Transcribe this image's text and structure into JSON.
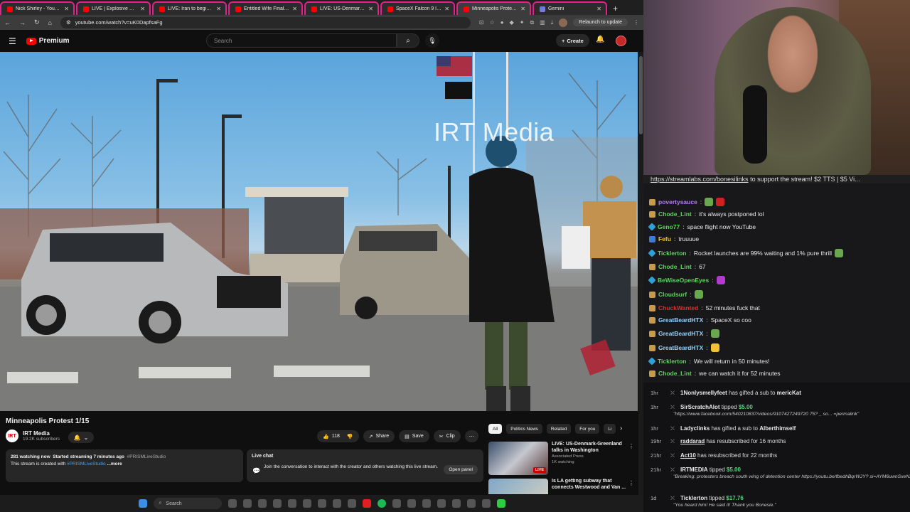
{
  "browser": {
    "tabs": [
      {
        "title": "Nick Shirley - YouTube",
        "active": false
      },
      {
        "title": "LIVE | Explosive House he",
        "active": false
      },
      {
        "title": "LIVE: Iran to begin public",
        "active": false
      },
      {
        "title": "Entitled Wife Finally Meet",
        "active": false
      },
      {
        "title": "LIVE: US-Denmark-Greenl",
        "active": false
      },
      {
        "title": "SpaceX Falcon 9 launche",
        "active": false
      },
      {
        "title": "Minneapolis Protest 1",
        "active": true
      },
      {
        "title": "Gemini",
        "active": false
      }
    ],
    "url": "youtube.com/watch?v=uK0DapfsaFg",
    "relaunch_label": "Relaunch to update"
  },
  "youtube": {
    "logo_text": "Premium",
    "search_placeholder": "Search",
    "create_label": "Create",
    "video": {
      "watermark": "IRT Media",
      "title": "Minneapolis Protest 1/15",
      "channel_name": "IRT Media",
      "channel_logo": "IRT",
      "subscribers": "19.2K subscribers",
      "likes": "118",
      "share_label": "Share",
      "save_label": "Save",
      "clip_label": "Clip"
    },
    "description": {
      "line1_watching": "281 watching now",
      "line1_started": "Started streaming 7 minutes ago",
      "line1_tag": "#PRISMLiveStudio",
      "line2_prefix": "This stream is created with ",
      "line2_tag": "#PRISMLiveStudio",
      "line2_more": " ...more"
    },
    "live_chat": {
      "label": "Live chat",
      "body": "Join the conversation to interact with the creator and others watching this live stream.",
      "open_panel": "Open panel"
    },
    "chips": [
      "All",
      "Politics News",
      "Related",
      "For you",
      "Li"
    ],
    "recommendations": [
      {
        "title": "LIVE: US-Denmark-Greenland talks in Washington",
        "channel": "Associated Press",
        "meta": "1K watching",
        "live": true,
        "badge": "LIVE"
      },
      {
        "title": "Is LA getting subway that connects Westwood and Van ...",
        "channel": "",
        "meta": "",
        "live": false,
        "badge": ""
      }
    ]
  },
  "stream": {
    "ticker_link": "https://streamlabs.com/bonesilinks",
    "ticker_text": " to support the stream! $2 TTS | $5 Vi..."
  },
  "chat": [
    {
      "user": "povertysauce",
      "color": "#b77aff",
      "text": "",
      "badge": "gold",
      "emotes": [
        "g",
        "r"
      ]
    },
    {
      "user": "Chode_Lint",
      "color": "#5fd35f",
      "text": "it's always postponed lol",
      "badge": "gold",
      "emotes": []
    },
    {
      "user": "Geno77",
      "color": "#5fd35f",
      "text": "space flight now YouTube",
      "badge": "blue",
      "emotes": []
    },
    {
      "user": "Fefu",
      "color": "#f1c232",
      "text": "truuuue",
      "badge": "prime",
      "emotes": []
    },
    {
      "user": "Ticklerton",
      "color": "#5fd35f",
      "text": "Rocket launches are 99% waiting and 1% pure thrill",
      "badge": "blue",
      "emotes": [
        "g"
      ]
    },
    {
      "user": "Chode_Lint",
      "color": "#5fd35f",
      "text": "67",
      "badge": "gold",
      "emotes": []
    },
    {
      "user": "BeWiseOpenEyes",
      "color": "#5fd35f",
      "text": "",
      "badge": "blue",
      "emotes": [
        "p"
      ]
    },
    {
      "user": "Cloudsurf",
      "color": "#5fd35f",
      "text": "",
      "badge": "gold",
      "emotes": [
        "g"
      ]
    },
    {
      "user": "ChuckWanted",
      "color": "#d03030",
      "text": "52 minutes fuck that",
      "badge": "gold",
      "emotes": []
    },
    {
      "user": "GreatBeardHTX",
      "color": "#8fd3ff",
      "text": "SpaceX so coo",
      "badge": "gold",
      "emotes": []
    },
    {
      "user": "GreatBeardHTX",
      "color": "#8fd3ff",
      "text": "",
      "badge": "gold",
      "emotes": [
        "g"
      ]
    },
    {
      "user": "GreatBeardHTX",
      "color": "#8fd3ff",
      "text": "",
      "badge": "gold",
      "emotes": [
        "y"
      ]
    },
    {
      "user": "Ticklerton",
      "color": "#5fd35f",
      "text": "We will return in 50 minutes!",
      "badge": "blue",
      "emotes": []
    },
    {
      "user": "Chode_Lint",
      "color": "#5fd35f",
      "text": "we can watch it for 52 minutes",
      "badge": "gold",
      "emotes": []
    }
  ],
  "events": [
    {
      "time": "1hr",
      "name": "1Nonlysmellyfeet",
      "text": " has gifted a sub to ",
      "target": "mericKat",
      "amount": "",
      "sub": ""
    },
    {
      "time": "1hr",
      "name": "SirScratchAlot",
      "text": " tipped ",
      "target": "",
      "amount": "$5.00",
      "sub": "\"https://www.facebook.com/540210837/videos/9107427249720 75? _ so... =permalink\""
    },
    {
      "time": "1hr",
      "name": "Ladyclinks",
      "text": " has gifted a sub to ",
      "target": "Alberthimself",
      "amount": "",
      "sub": ""
    },
    {
      "time": "19hr",
      "name": "raddarad",
      "text": " has resubscribed for 16 months",
      "target": "",
      "amount": "",
      "sub": ""
    },
    {
      "time": "21hr",
      "name": "Act10",
      "text": " has resubscribed for 22 months",
      "target": "",
      "amount": "",
      "sub": ""
    },
    {
      "time": "21hr",
      "name": "IRTMEDIA",
      "text": " tipped ",
      "target": "",
      "amount": "$5.00",
      "sub": "\"Breaking: protesters breach south wing of detention center https://youtu.be/fbedhBqrWJY? si=AYM6uwnSxeNx6Elc\""
    },
    {
      "time": "1d",
      "name": "Ticklerton",
      "text": " tipped ",
      "target": "",
      "amount": "$17.76",
      "sub": "\"You heard him! He said it! Thank you Bonesie.\""
    }
  ],
  "taskbar": {
    "search_label": "Search"
  }
}
